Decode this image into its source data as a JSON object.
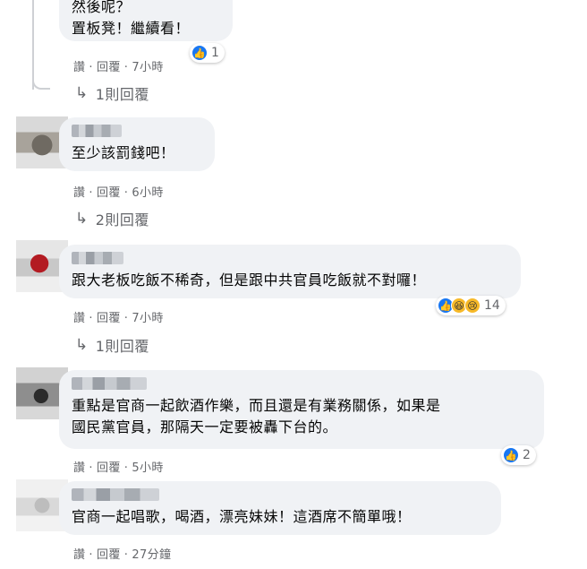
{
  "comments": [
    {
      "text": "然後呢？\n置板凳！繼續看！",
      "actions": {
        "like": "讚",
        "reply": "回覆",
        "time": "7小時"
      },
      "reactions": {
        "icons": [
          "like-icon"
        ],
        "count": "1"
      },
      "replies": "1則回覆"
    },
    {
      "text": "至少該罰錢吧！",
      "actions": {
        "like": "讚",
        "reply": "回覆",
        "time": "6小時"
      },
      "replies": "2則回覆"
    },
    {
      "text": "跟大老板吃飯不稀奇，但是跟中共官員吃飯就不對囉！",
      "actions": {
        "like": "讚",
        "reply": "回覆",
        "time": "7小時"
      },
      "reactions": {
        "icons": [
          "like-icon",
          "haha-icon",
          "sad-icon"
        ],
        "count": "14"
      },
      "replies": "1則回覆"
    },
    {
      "text": "重點是官商一起飲酒作樂，而且還是有業務關係，如果是\n國民黨官員，那隔天一定要被轟下台的。",
      "actions": {
        "like": "讚",
        "reply": "回覆",
        "time": "5小時"
      },
      "reactions": {
        "icons": [
          "like-icon"
        ],
        "count": "2"
      }
    },
    {
      "text": "官商一起唱歌，喝酒，漂亮妹妹！這酒席不簡單哦！",
      "actions": {
        "like": "讚",
        "reply": "回覆",
        "time": "27分鐘"
      }
    }
  ],
  "separator": "·",
  "colors": {
    "like": "#1877f2",
    "bubble": "#f0f2f5",
    "meta": "#65676b"
  }
}
